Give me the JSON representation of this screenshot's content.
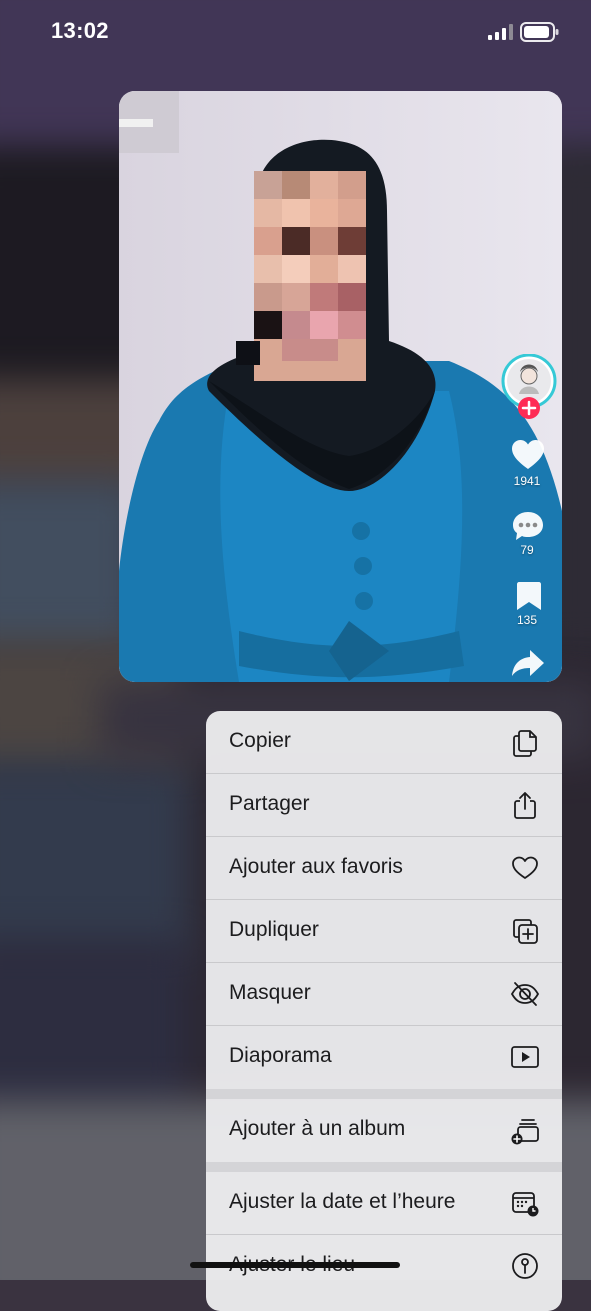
{
  "status_bar": {
    "time": "13:02"
  },
  "video": {
    "likes": "1941",
    "comments": "79",
    "saves": "135"
  },
  "menu": {
    "items": [
      {
        "label": "Copier",
        "icon": "copy-icon"
      },
      {
        "label": "Partager",
        "icon": "share-icon"
      },
      {
        "label": "Ajouter aux favoris",
        "icon": "heart-icon"
      },
      {
        "label": "Dupliquer",
        "icon": "duplicate-icon"
      },
      {
        "label": "Masquer",
        "icon": "eye-slash-icon"
      },
      {
        "label": "Diaporama",
        "icon": "play-icon"
      },
      {
        "label": "Ajouter à un album",
        "icon": "add-album-icon"
      },
      {
        "label": "Ajuster la date et l’heure",
        "icon": "calendar-clock-icon"
      },
      {
        "label": "Ajuster le lieu",
        "icon": "location-info-icon"
      }
    ]
  }
}
